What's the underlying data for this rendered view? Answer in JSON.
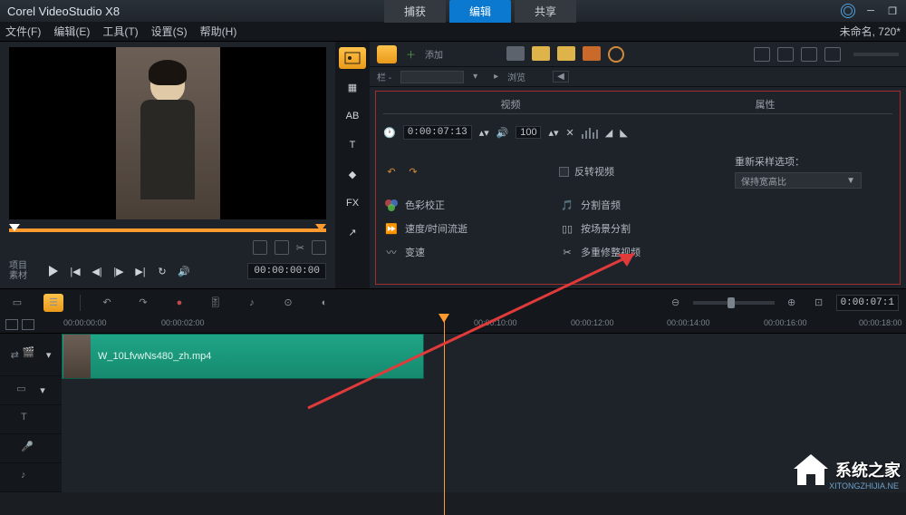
{
  "app": {
    "title": "Corel VideoStudio X8"
  },
  "main_tabs": {
    "capture": "捕获",
    "edit": "编辑",
    "share": "共享",
    "active": "edit"
  },
  "menus": {
    "file": "文件(F)",
    "edit": "编辑(E)",
    "tools": "工具(T)",
    "settings": "设置(S)",
    "help": "帮助(H)"
  },
  "status": {
    "doc": "未命名, 720*"
  },
  "preview": {
    "label_project": "项目",
    "label_clip": "素材",
    "timecode": "00:00:00:00"
  },
  "options": {
    "add": "添加",
    "browse": "浏览",
    "group": "栏 -",
    "tab_video": "视频",
    "tab_attr": "属性",
    "duration": "0:00:07:13",
    "volume": "100",
    "reverse": "反转视频",
    "resample_label": "重新采样选项：",
    "resample_value": "保持宽高比",
    "cc_icon": "↶",
    "color_correct": "色彩校正",
    "split_audio": "分割音频",
    "speed": "速度/时间流逝",
    "scene_split": "按场景分割",
    "variable": "变速",
    "multi_trim": "多重修整视频"
  },
  "timeline": {
    "timecode": "0:00:07:1",
    "ruler": [
      "00:00:00:00",
      "00:00:02:00",
      "00:00:10:00",
      "00:00:12:00",
      "00:00:14:00",
      "00:00:16:00",
      "00:00:18:00"
    ],
    "clip_name": "W_10LfvwNs480_zh.mp4"
  },
  "watermark": {
    "text": "系统之家",
    "url": "XITONGZHIJIA.NE"
  }
}
